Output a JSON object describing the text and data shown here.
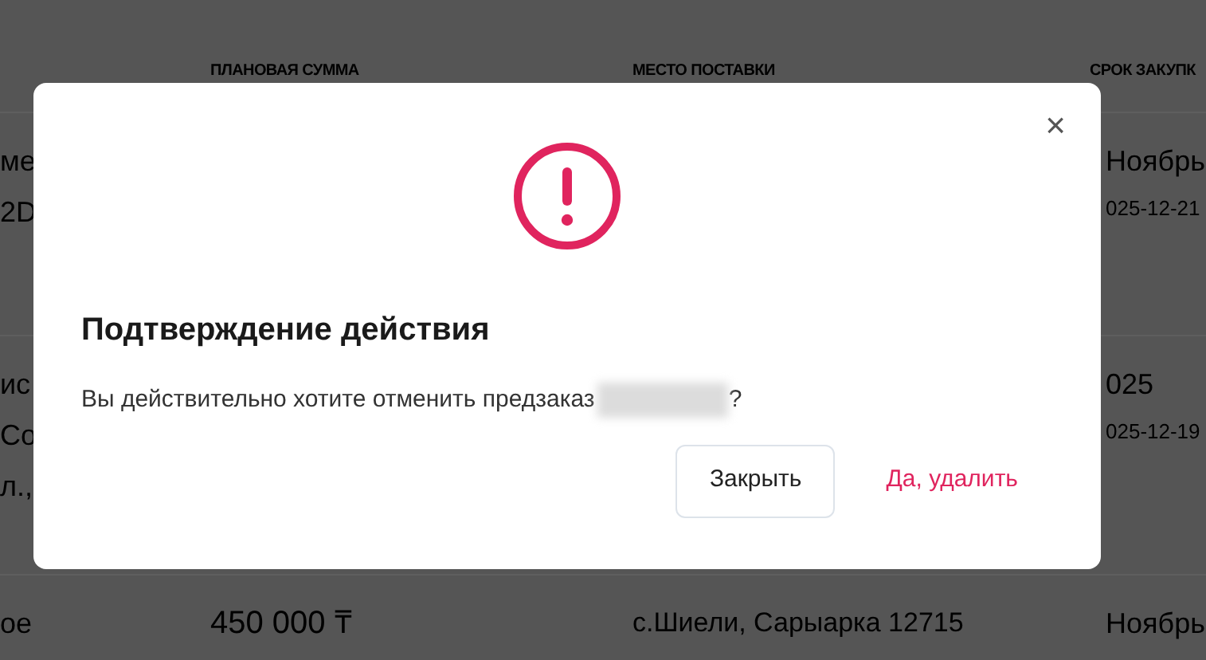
{
  "table": {
    "columns": [
      {
        "label": "ПЛАНОВАЯ СУММА"
      },
      {
        "label": "МЕСТО ПОСТАВКИ"
      },
      {
        "label": "СРОК ЗАКУПК"
      }
    ],
    "rows": [
      {
        "column_1": [
          "ме",
          "2D"
        ],
        "amount": "",
        "place": "",
        "date": "Ноябрь",
        "date_sub": "025-12-21"
      },
      {
        "column_1": [
          "ис",
          "Со",
          "л.,"
        ],
        "amount": "",
        "place": "",
        "date": "025",
        "date_sub": "025-12-19"
      },
      {
        "column_1": [
          "ое"
        ],
        "amount": "450 000 ₸",
        "place": "с.Шиели, Сарыарка 12715",
        "date": "Ноябрь",
        "date_sub": ""
      }
    ]
  },
  "dialog": {
    "title": "Подтверждение действия",
    "message": "Вы действительно хотите отменить предзаказ",
    "message_end": "?",
    "close_label": "×",
    "buttons": [
      {
        "label": "Закрыть",
        "kind": "outline"
      },
      {
        "label": "Да, удалить",
        "kind": "danger"
      }
    ]
  }
}
